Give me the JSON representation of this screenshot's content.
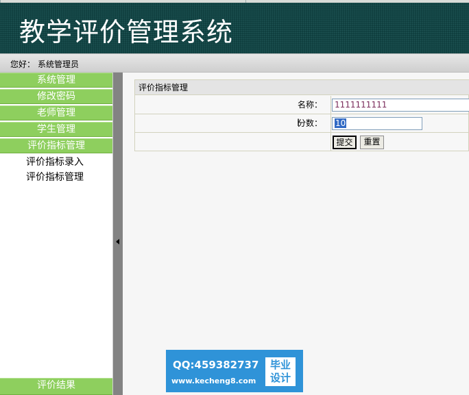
{
  "header": {
    "title": "教学评价管理系统"
  },
  "userbar": {
    "greeting": "您好：",
    "role": "系统管理员"
  },
  "sidebar": {
    "menus": [
      {
        "label": "系统管理"
      },
      {
        "label": "修改密码"
      },
      {
        "label": "老师管理"
      },
      {
        "label": "学生管理"
      },
      {
        "label": "评价指标管理"
      }
    ],
    "submenu": [
      {
        "label": "评价指标录入"
      },
      {
        "label": "评价指标管理"
      }
    ],
    "bottom_menu": {
      "label": "评价结果"
    }
  },
  "form": {
    "title": "评价指标管理",
    "name_label": "名称：",
    "name_value": "1111111111",
    "score_label": "分数：",
    "score_value": "10",
    "submit_label": "提交",
    "reset_label": "重置"
  },
  "watermark": {
    "qq": "QQ:459382737",
    "url": "www.kecheng8.com",
    "badge_line1": "毕业",
    "badge_line2": "设计"
  },
  "colors": {
    "banner": "#0c3a3a",
    "menu_green": "#8ecf5e",
    "selection": "#316ac5",
    "watermark_blue": "#2f93d8"
  }
}
